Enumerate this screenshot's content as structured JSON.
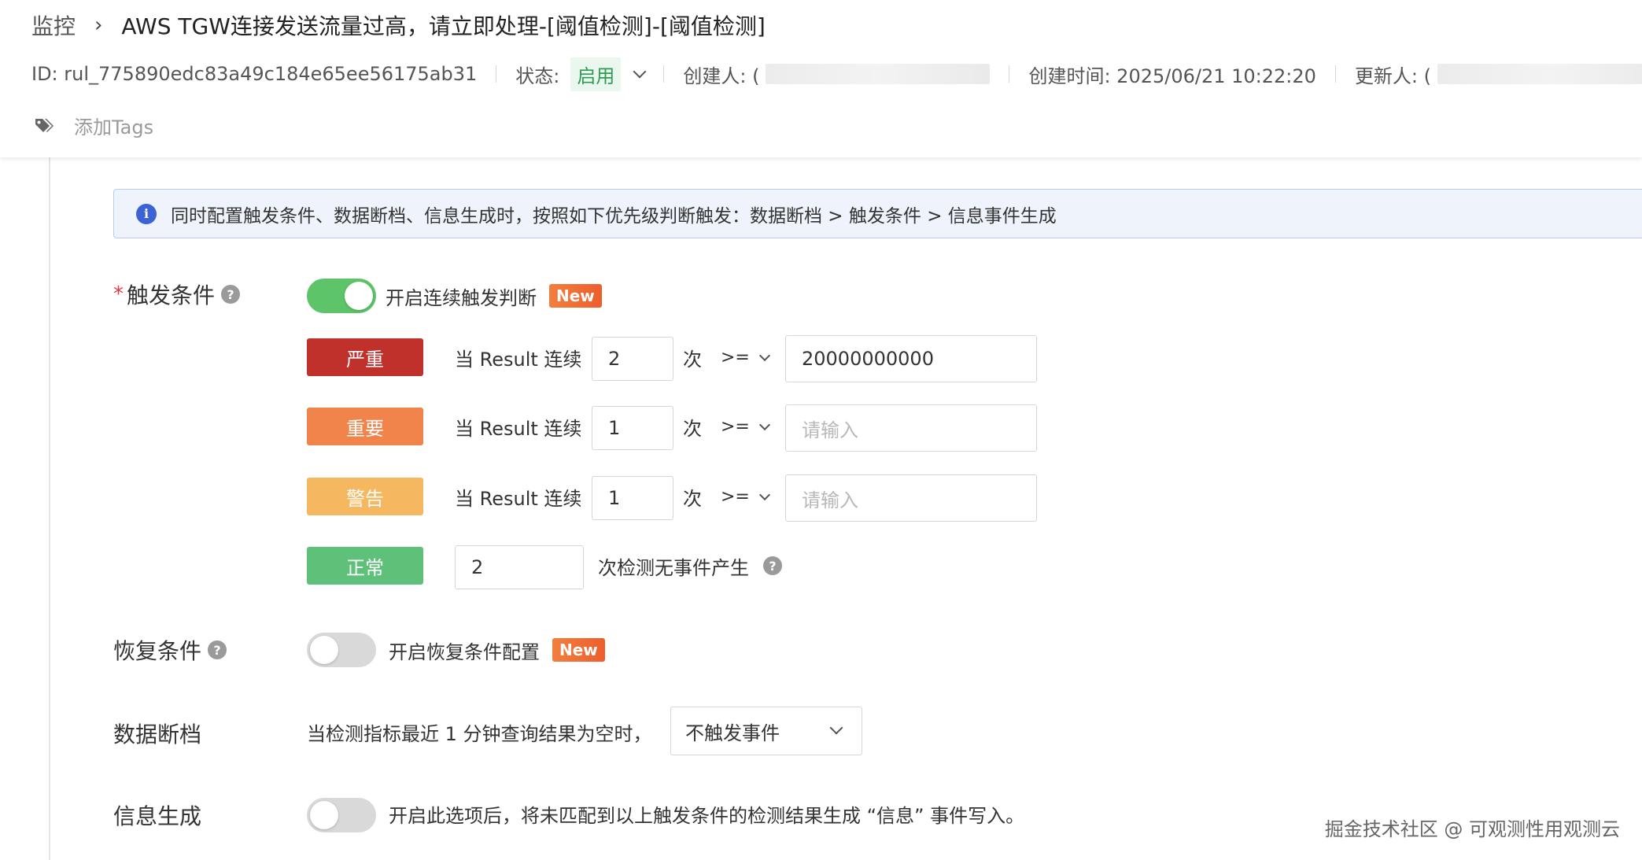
{
  "breadcrumb": {
    "root": "监控",
    "title": "AWS TGW连接发送流量过高，请立即处理-[阈值检测]-[阈值检测]"
  },
  "meta": {
    "id": "ID: rul_775890edc83a49c184e65ee56175ab31",
    "status_label": "状态:",
    "status_value": "启用",
    "creator_label": "创建人: (",
    "created_time": "创建时间: 2025/06/21 10:22:20",
    "updater_label": "更新人: ("
  },
  "tags": {
    "add_label": "添加Tags"
  },
  "alert": {
    "text": "同时配置触发条件、数据断档、信息生成时，按照如下优先级判断触发：数据断档 > 触发条件 > 信息事件生成"
  },
  "trigger": {
    "label": "触发条件",
    "toggle_label": "开启连续触发判断",
    "new_badge": "New",
    "rows": [
      {
        "level": "严重",
        "prefix": "当 Result 连续",
        "count": "2",
        "unit": "次",
        "operator": ">=",
        "value": "20000000000",
        "placeholder": ""
      },
      {
        "level": "重要",
        "prefix": "当 Result 连续",
        "count": "1",
        "unit": "次",
        "operator": ">=",
        "value": "",
        "placeholder": "请输入"
      },
      {
        "level": "警告",
        "prefix": "当 Result 连续",
        "count": "1",
        "unit": "次",
        "operator": ">=",
        "value": "",
        "placeholder": "请输入"
      }
    ],
    "normal": {
      "level": "正常",
      "count": "2",
      "suffix": "次检测无事件产生"
    }
  },
  "recovery": {
    "label": "恢复条件",
    "toggle_label": "开启恢复条件配置",
    "new_badge": "New"
  },
  "nodata": {
    "label": "数据断档",
    "text": "当检测指标最近 1 分钟查询结果为空时，",
    "select_value": "不触发事件"
  },
  "info": {
    "label": "信息生成",
    "toggle_label": "开启此选项后，将未匹配到以上触发条件的检测结果生成 “信息” 事件写入。"
  },
  "watermark": "掘金技术社区 @ 可观测性用观测云",
  "colors": {
    "critical": "#c1312b",
    "important": "#f0844a",
    "warning": "#f5b861",
    "normal": "#5fc07a",
    "switch_on": "#5dc46a",
    "accent": "#3b63d6"
  }
}
